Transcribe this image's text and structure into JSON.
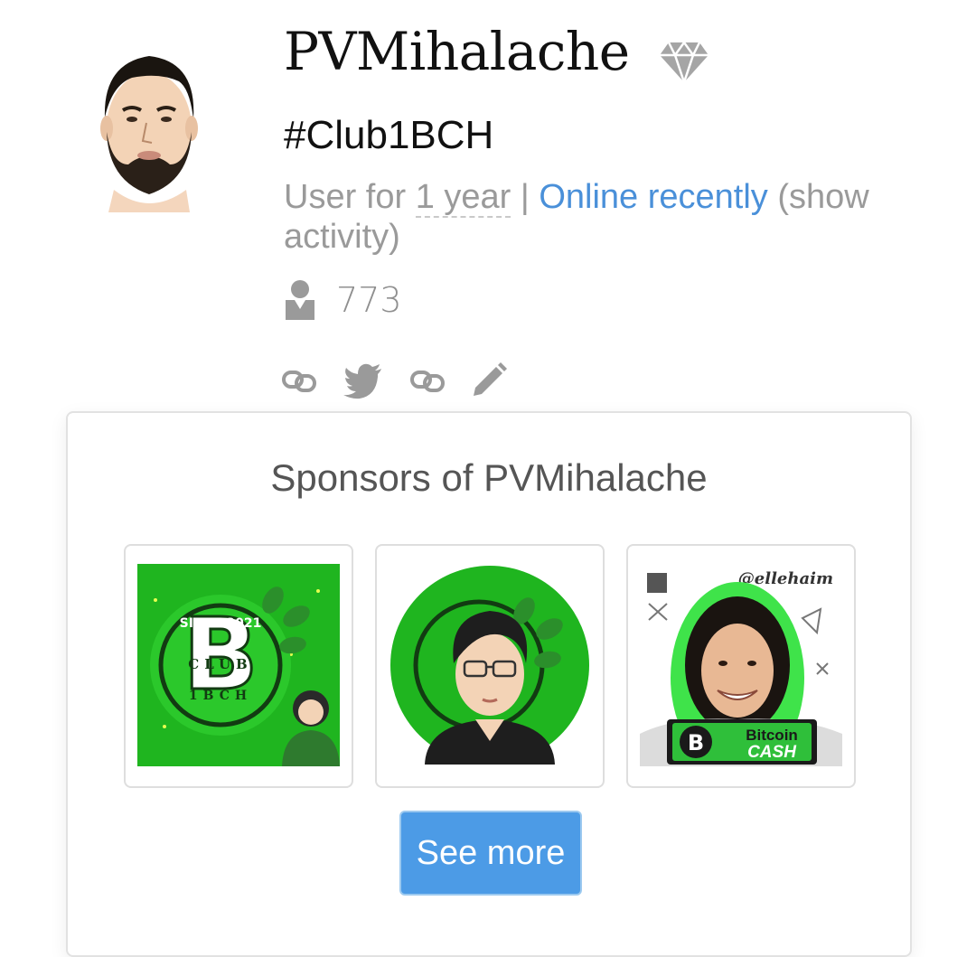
{
  "profile": {
    "username": "PVMihalache",
    "bio": "#Club1BCH",
    "user_for_prefix": "User for ",
    "user_for_value": "1 year",
    "separator": " | ",
    "online_status": "Online recently",
    "show_activity": " (show activity)",
    "subscribers_count": "773"
  },
  "social_icons": [
    "link-icon",
    "twitter-icon",
    "link-icon",
    "pencil-icon"
  ],
  "sponsors": {
    "title": "Sponsors of PVMihalache",
    "see_more_label": "See more",
    "tiles": [
      {
        "badge_top": "SINCE 2021",
        "badge_mid": "CLUB",
        "badge_bottom": "1BCH"
      },
      {
        "badge_top": "",
        "badge_mid": "",
        "badge_bottom": ""
      },
      {
        "handle": "@ellehaim",
        "brand_line1": "Bitcoin",
        "brand_line2": "CASH"
      }
    ]
  },
  "colors": {
    "accent_link": "#4a90d9",
    "button_bg": "#4c9be6",
    "muted_text": "#9a9a9a",
    "sponsor_green": "#1fb51f"
  }
}
